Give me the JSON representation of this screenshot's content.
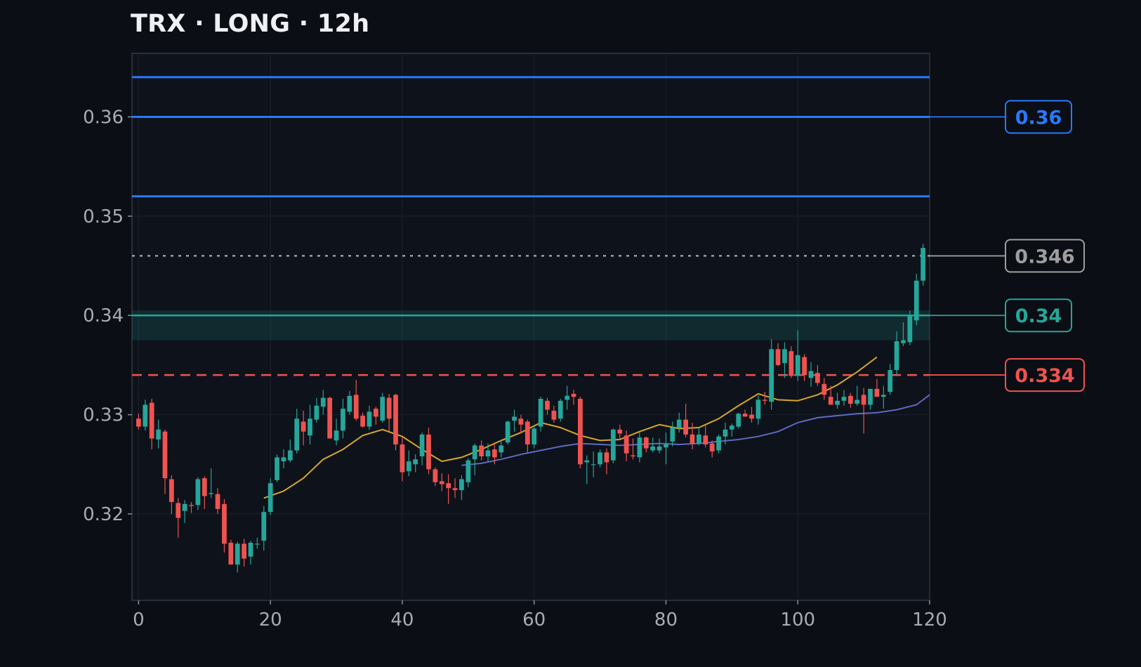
{
  "chart_data": {
    "type": "candlestick",
    "title": "TRX · LONG · 12h",
    "xlabel": "",
    "ylabel": "",
    "xlim": [
      -1,
      120
    ],
    "ylim": [
      0.3113,
      0.3664
    ],
    "x_ticks": [
      "0",
      "20",
      "40",
      "60",
      "80",
      "100",
      "120"
    ],
    "y_ticks": [
      "0.32",
      "0.33",
      "0.34",
      "0.35",
      "0.36"
    ],
    "grid": true,
    "colors": {
      "background": "#0b0e14",
      "up": "#26a69a",
      "down": "#ef5350",
      "take_profit": "#2979ff",
      "entry": "#26a69a",
      "stop": "#ef5350",
      "current": "#9e9e9e",
      "ma_fast": "#d4a72c",
      "ma_slow": "#5c6bc0"
    },
    "levels": {
      "take_profit": [
        0.364,
        0.36,
        0.352
      ],
      "entry": 0.34,
      "entry_zone": [
        0.3375,
        0.3405
      ],
      "stop": 0.334,
      "current": 0.346
    },
    "price_tags": [
      {
        "label": "0.36",
        "value": 0.36,
        "kind": "take_profit"
      },
      {
        "label": "0.346",
        "value": 0.346,
        "kind": "current"
      },
      {
        "label": "0.34",
        "value": 0.34,
        "kind": "entry"
      },
      {
        "label": "0.334",
        "value": 0.334,
        "kind": "stop"
      }
    ],
    "candles": [
      [
        0.3296,
        0.3301,
        0.3285,
        0.3288
      ],
      [
        0.3288,
        0.3315,
        0.3284,
        0.331
      ],
      [
        0.3312,
        0.3316,
        0.3265,
        0.3276
      ],
      [
        0.3275,
        0.3295,
        0.3266,
        0.3285
      ],
      [
        0.3283,
        0.3285,
        0.322,
        0.3236
      ],
      [
        0.3235,
        0.3239,
        0.32,
        0.3212
      ],
      [
        0.3211,
        0.3216,
        0.3176,
        0.3196
      ],
      [
        0.3203,
        0.3214,
        0.3191,
        0.321
      ],
      [
        0.3209,
        0.3212,
        0.3201,
        0.3208
      ],
      [
        0.3209,
        0.3237,
        0.3204,
        0.3235
      ],
      [
        0.3236,
        0.3238,
        0.3205,
        0.3218
      ],
      [
        0.322,
        0.3246,
        0.3216,
        0.3221
      ],
      [
        0.322,
        0.3226,
        0.32,
        0.3205
      ],
      [
        0.321,
        0.3215,
        0.3161,
        0.317
      ],
      [
        0.3171,
        0.3174,
        0.3149,
        0.3149
      ],
      [
        0.3149,
        0.3172,
        0.3141,
        0.317
      ],
      [
        0.317,
        0.3175,
        0.3147,
        0.3155
      ],
      [
        0.3157,
        0.3173,
        0.3149,
        0.3171
      ],
      [
        0.317,
        0.3176,
        0.3165,
        0.317
      ],
      [
        0.3173,
        0.3208,
        0.3163,
        0.3202
      ],
      [
        0.3202,
        0.3236,
        0.3199,
        0.3231
      ],
      [
        0.3234,
        0.326,
        0.3232,
        0.3257
      ],
      [
        0.3253,
        0.3265,
        0.3246,
        0.3257
      ],
      [
        0.3254,
        0.3275,
        0.3252,
        0.3264
      ],
      [
        0.3264,
        0.3306,
        0.3261,
        0.3296
      ],
      [
        0.3293,
        0.3304,
        0.3269,
        0.3283
      ],
      [
        0.3279,
        0.331,
        0.327,
        0.3296
      ],
      [
        0.3295,
        0.3317,
        0.3292,
        0.3309
      ],
      [
        0.3308,
        0.3325,
        0.33,
        0.3317
      ],
      [
        0.3317,
        0.3318,
        0.3276,
        0.3276
      ],
      [
        0.3274,
        0.3296,
        0.3269,
        0.3284
      ],
      [
        0.3284,
        0.3316,
        0.3276,
        0.3306
      ],
      [
        0.3303,
        0.3324,
        0.33,
        0.3319
      ],
      [
        0.332,
        0.3335,
        0.3294,
        0.3296
      ],
      [
        0.3299,
        0.3302,
        0.3287,
        0.3288
      ],
      [
        0.3288,
        0.3309,
        0.3285,
        0.3303
      ],
      [
        0.3306,
        0.3308,
        0.329,
        0.3298
      ],
      [
        0.3294,
        0.3322,
        0.3292,
        0.3318
      ],
      [
        0.3317,
        0.3321,
        0.3283,
        0.3296
      ],
      [
        0.332,
        0.3321,
        0.3264,
        0.327
      ],
      [
        0.327,
        0.3277,
        0.3233,
        0.3242
      ],
      [
        0.3243,
        0.3264,
        0.3238,
        0.3253
      ],
      [
        0.325,
        0.326,
        0.3242,
        0.3255
      ],
      [
        0.3258,
        0.3282,
        0.3249,
        0.328
      ],
      [
        0.328,
        0.3287,
        0.324,
        0.3245
      ],
      [
        0.3245,
        0.3247,
        0.3228,
        0.3232
      ],
      [
        0.3233,
        0.3241,
        0.3223,
        0.323
      ],
      [
        0.3231,
        0.324,
        0.321,
        0.3226
      ],
      [
        0.3226,
        0.3236,
        0.3216,
        0.3224
      ],
      [
        0.3224,
        0.3239,
        0.3214,
        0.3235
      ],
      [
        0.3232,
        0.3256,
        0.3227,
        0.3254
      ],
      [
        0.3255,
        0.3271,
        0.3239,
        0.3269
      ],
      [
        0.3269,
        0.3274,
        0.3254,
        0.3258
      ],
      [
        0.3258,
        0.3271,
        0.3253,
        0.3264
      ],
      [
        0.3265,
        0.3271,
        0.325,
        0.3257
      ],
      [
        0.3262,
        0.3275,
        0.3257,
        0.3269
      ],
      [
        0.3272,
        0.3294,
        0.327,
        0.3293
      ],
      [
        0.3294,
        0.3305,
        0.3283,
        0.3298
      ],
      [
        0.3296,
        0.33,
        0.3281,
        0.329
      ],
      [
        0.3293,
        0.3295,
        0.3262,
        0.327
      ],
      [
        0.327,
        0.3289,
        0.3266,
        0.3286
      ],
      [
        0.3288,
        0.3318,
        0.3283,
        0.3316
      ],
      [
        0.3314,
        0.3317,
        0.33,
        0.3305
      ],
      [
        0.3304,
        0.3309,
        0.3292,
        0.3295
      ],
      [
        0.3296,
        0.3316,
        0.3293,
        0.3314
      ],
      [
        0.3315,
        0.3329,
        0.3305,
        0.3319
      ],
      [
        0.3321,
        0.3325,
        0.331,
        0.3318
      ],
      [
        0.3316,
        0.3318,
        0.3246,
        0.325
      ],
      [
        0.3252,
        0.3259,
        0.323,
        0.3254
      ],
      [
        0.325,
        0.3263,
        0.3237,
        0.325
      ],
      [
        0.325,
        0.3265,
        0.3247,
        0.3262
      ],
      [
        0.3262,
        0.3266,
        0.324,
        0.3252
      ],
      [
        0.3254,
        0.3286,
        0.3251,
        0.3285
      ],
      [
        0.3285,
        0.329,
        0.3275,
        0.3281
      ],
      [
        0.3279,
        0.3284,
        0.3253,
        0.3261
      ],
      [
        0.3259,
        0.3276,
        0.3255,
        0.3258
      ],
      [
        0.3257,
        0.3282,
        0.3252,
        0.3277
      ],
      [
        0.3277,
        0.3278,
        0.3262,
        0.3266
      ],
      [
        0.3264,
        0.3277,
        0.3262,
        0.3268
      ],
      [
        0.3264,
        0.3276,
        0.3261,
        0.3268
      ],
      [
        0.3267,
        0.3282,
        0.325,
        0.327
      ],
      [
        0.3273,
        0.3293,
        0.3268,
        0.3287
      ],
      [
        0.3287,
        0.3302,
        0.3282,
        0.3295
      ],
      [
        0.3295,
        0.3311,
        0.3277,
        0.328
      ],
      [
        0.328,
        0.3292,
        0.3265,
        0.3271
      ],
      [
        0.3271,
        0.3287,
        0.3269,
        0.328
      ],
      [
        0.3279,
        0.3289,
        0.3267,
        0.327
      ],
      [
        0.3271,
        0.3274,
        0.3257,
        0.3263
      ],
      [
        0.3264,
        0.328,
        0.3261,
        0.3278
      ],
      [
        0.3278,
        0.3292,
        0.327,
        0.3285
      ],
      [
        0.3285,
        0.3291,
        0.3278,
        0.3289
      ],
      [
        0.3288,
        0.3302,
        0.3286,
        0.3301
      ],
      [
        0.3301,
        0.3305,
        0.3299,
        0.3298
      ],
      [
        0.33,
        0.3308,
        0.3292,
        0.3296
      ],
      [
        0.3296,
        0.3319,
        0.329,
        0.3315
      ],
      [
        0.3315,
        0.3323,
        0.331,
        0.3314
      ],
      [
        0.3313,
        0.3376,
        0.3305,
        0.3366
      ],
      [
        0.3366,
        0.3372,
        0.3349,
        0.335
      ],
      [
        0.3352,
        0.3373,
        0.3337,
        0.3366
      ],
      [
        0.3364,
        0.3369,
        0.3337,
        0.3339
      ],
      [
        0.3339,
        0.3385,
        0.3334,
        0.336
      ],
      [
        0.3358,
        0.3361,
        0.3334,
        0.334
      ],
      [
        0.3337,
        0.3353,
        0.3328,
        0.3344
      ],
      [
        0.3342,
        0.335,
        0.3329,
        0.3332
      ],
      [
        0.3331,
        0.3337,
        0.3315,
        0.332
      ],
      [
        0.3318,
        0.3329,
        0.3312,
        0.331
      ],
      [
        0.331,
        0.3322,
        0.3306,
        0.3314
      ],
      [
        0.3314,
        0.3325,
        0.3309,
        0.3318
      ],
      [
        0.3319,
        0.3322,
        0.3307,
        0.3311
      ],
      [
        0.3311,
        0.3329,
        0.3309,
        0.3315
      ],
      [
        0.332,
        0.3327,
        0.3281,
        0.331
      ],
      [
        0.331,
        0.3321,
        0.3305,
        0.3326
      ],
      [
        0.3326,
        0.3336,
        0.3321,
        0.3318
      ],
      [
        0.3318,
        0.3329,
        0.3306,
        0.332
      ],
      [
        0.3323,
        0.3351,
        0.332,
        0.3345
      ],
      [
        0.3345,
        0.3384,
        0.334,
        0.3374
      ],
      [
        0.3372,
        0.3393,
        0.3369,
        0.3375
      ],
      [
        0.3373,
        0.3405,
        0.337,
        0.34
      ],
      [
        0.3395,
        0.3442,
        0.339,
        0.3435
      ],
      [
        0.3435,
        0.3472,
        0.343,
        0.3468
      ]
    ],
    "ma_fast": {
      "start_x": 19,
      "step": 3,
      "values": [
        0.3216,
        0.3223,
        0.3236,
        0.3255,
        0.3265,
        0.3279,
        0.3285,
        0.3278,
        0.3265,
        0.3253,
        0.3257,
        0.3265,
        0.3274,
        0.3282,
        0.3292,
        0.3287,
        0.3279,
        0.3274,
        0.3275,
        0.3283,
        0.329,
        0.3286,
        0.3287,
        0.3296,
        0.3309,
        0.3321,
        0.3315,
        0.3314,
        0.332,
        0.333,
        0.3343,
        0.3358
      ]
    },
    "ma_slow": {
      "start_x": 49,
      "step": 3,
      "values": [
        0.3249,
        0.3251,
        0.3255,
        0.326,
        0.3264,
        0.3268,
        0.3271,
        0.327,
        0.3269,
        0.327,
        0.3271,
        0.327,
        0.3271,
        0.3273,
        0.3275,
        0.3278,
        0.3283,
        0.3292,
        0.3297,
        0.3299,
        0.3301,
        0.3302,
        0.3305,
        0.331,
        0.3325
      ]
    }
  }
}
